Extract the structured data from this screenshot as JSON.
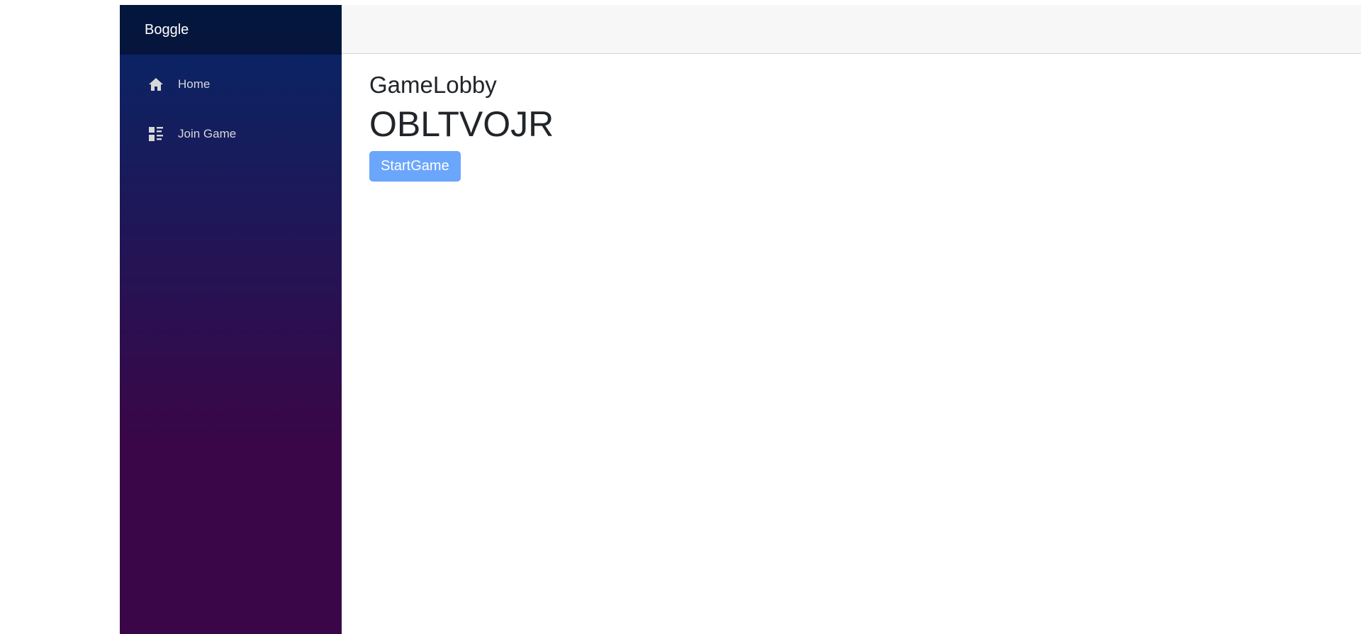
{
  "sidebar": {
    "brand": "Boggle",
    "items": [
      {
        "label": "Home",
        "icon": "home-icon"
      },
      {
        "label": "Join Game",
        "icon": "list-icon"
      }
    ]
  },
  "main": {
    "title": "GameLobby",
    "game_code": "OBLTVOJR",
    "start_button_label": "StartGame"
  },
  "colors": {
    "sidebar_gradient_top": "#052767",
    "sidebar_gradient_bottom": "#3a0647",
    "button_bg": "#6aa6fc",
    "top_row_bg": "#f7f7f7"
  }
}
